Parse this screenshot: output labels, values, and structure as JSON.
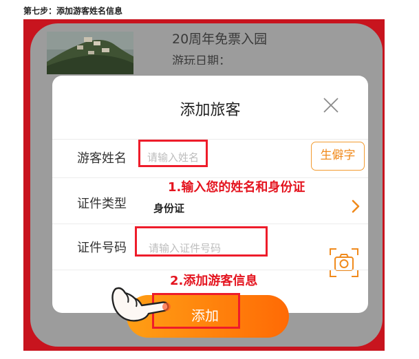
{
  "step_title": "第七步：添加游客姓名信息",
  "background_card": {
    "ticket_title": "20周年免票入园",
    "visit_date_label": "游玩日期："
  },
  "dialog": {
    "title": "添加旅客",
    "close_icon": "close-icon",
    "fields": {
      "name": {
        "label": "游客姓名",
        "placeholder": "请输入姓名",
        "value": ""
      },
      "id_type": {
        "label": "证件类型",
        "value": "身份证"
      },
      "id_number": {
        "label": "证件号码",
        "placeholder": "请输入证件号码",
        "value": ""
      }
    },
    "rare_char_button": "生僻字",
    "camera_icon": "camera-icon",
    "chevron_icon": "chevron-right-icon"
  },
  "add_button": {
    "label": "添加"
  },
  "annotations": {
    "step1": "1.输入您的姓名和身份证",
    "step2": "2.添加游客信息"
  },
  "colors": {
    "frame_red": "#c8141e",
    "highlight_red": "#ee1c2a",
    "annotation_red": "#e4141f",
    "accent_orange": "#f08a1c",
    "button_gradient_start": "#ff9f15",
    "button_gradient_end": "#ff6a05"
  }
}
